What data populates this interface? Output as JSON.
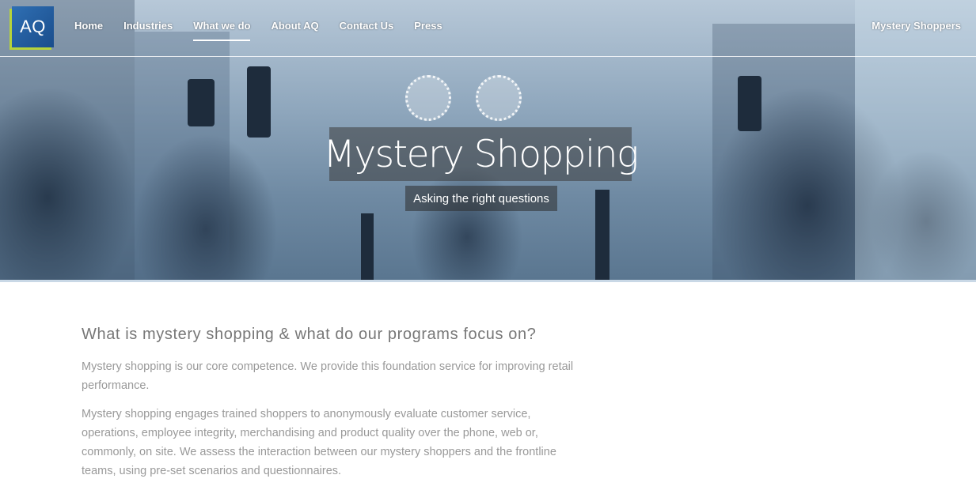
{
  "logo": {
    "text": "AQ"
  },
  "nav": {
    "items": [
      {
        "label": "Home",
        "active": false
      },
      {
        "label": "Industries",
        "active": false
      },
      {
        "label": "What we do",
        "active": true
      },
      {
        "label": "About AQ",
        "active": false
      },
      {
        "label": "Contact Us",
        "active": false
      },
      {
        "label": "Press",
        "active": false
      }
    ],
    "right_link": "Mystery Shoppers"
  },
  "hero": {
    "title": "Mystery Shopping",
    "subtitle": "Asking the right questions"
  },
  "content": {
    "heading": "What is mystery shopping & what do our programs focus on?",
    "paragraphs": [
      "Mystery shopping is our core competence. We provide this foundation service for improving retail performance.",
      "Mystery shopping engages trained shoppers to anonymously evaluate customer service, operations, employee integrity, merchandising and product quality over the phone, web or, commonly, on site. We assess the interaction between our mystery shoppers and the frontline teams, using pre-set scenarios and questionnaires."
    ]
  },
  "colors": {
    "logo_bg": "#1a4d8c",
    "logo_accent": "#b6d33a",
    "heading": "#777777",
    "body_text": "#999999"
  }
}
